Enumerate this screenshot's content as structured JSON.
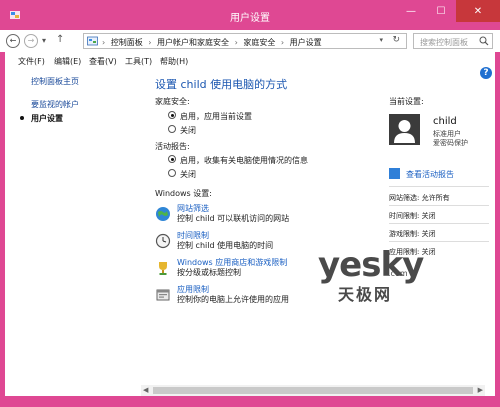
{
  "window": {
    "title": "用户设置",
    "minimize_glyph": "—",
    "maximize_glyph": "☐",
    "close_glyph": "✕"
  },
  "nav": {
    "back_glyph": "←",
    "forward_glyph": "→",
    "recent_glyph": "▾",
    "up_glyph": "↑",
    "breadcrumbs": [
      "控制面板",
      "用户帐户和家庭安全",
      "家庭安全",
      "用户设置"
    ],
    "crumb_separator": "›",
    "dropdown_glyph": "▾",
    "refresh_glyph": "↻",
    "search_placeholder": "搜索控制面板"
  },
  "menu": {
    "file": "文件(F)",
    "edit": "编辑(E)",
    "view": "查看(V)",
    "tools": "工具(T)",
    "help": "帮助(H)",
    "help_icon_glyph": "?"
  },
  "sidebar": {
    "items": [
      {
        "label": "控制面板主页"
      },
      {
        "label": "要监视的帐户"
      },
      {
        "label": "用户设置"
      }
    ]
  },
  "main": {
    "heading": "设置 child 使用电脑的方式",
    "family_safety_label": "家庭安全:",
    "family_on": "启用，应用当前设置",
    "family_off": "关闭",
    "activity_label": "活动报告:",
    "activity_on": "启用，收集有关电脑使用情况的信息",
    "activity_off": "关闭",
    "windows_settings_label": "Windows 设置:",
    "settings": [
      {
        "icon": "globe-icon",
        "link": "网站筛选",
        "desc": "控制 child 可以联机访问的网站"
      },
      {
        "icon": "clock-icon",
        "link": "时间限制",
        "desc": "控制 child 使用电脑的时间"
      },
      {
        "icon": "trophy-icon",
        "link": "Windows 应用商店和游戏限制",
        "desc": "按分级或标题控制"
      },
      {
        "icon": "app-icon",
        "link": "应用限制",
        "desc": "控制你的电脑上允许使用的应用"
      }
    ]
  },
  "current": {
    "title": "当前设置:",
    "user_name": "child",
    "user_role": "标准用户",
    "user_family": "爱密码保护",
    "activity_link": "查看活动报告",
    "stats": [
      "网站筛选: 允许所有",
      "时间限制: 关闭",
      "游戏限制: 关闭",
      "应用限制: 关闭"
    ]
  },
  "watermark": {
    "main": "yesky",
    "domain": ".com",
    "cn": "天极网"
  },
  "colors": {
    "accent": "#df4893",
    "link": "#1a5fc2",
    "heading": "#1a56b0",
    "close": "#c7373b"
  }
}
